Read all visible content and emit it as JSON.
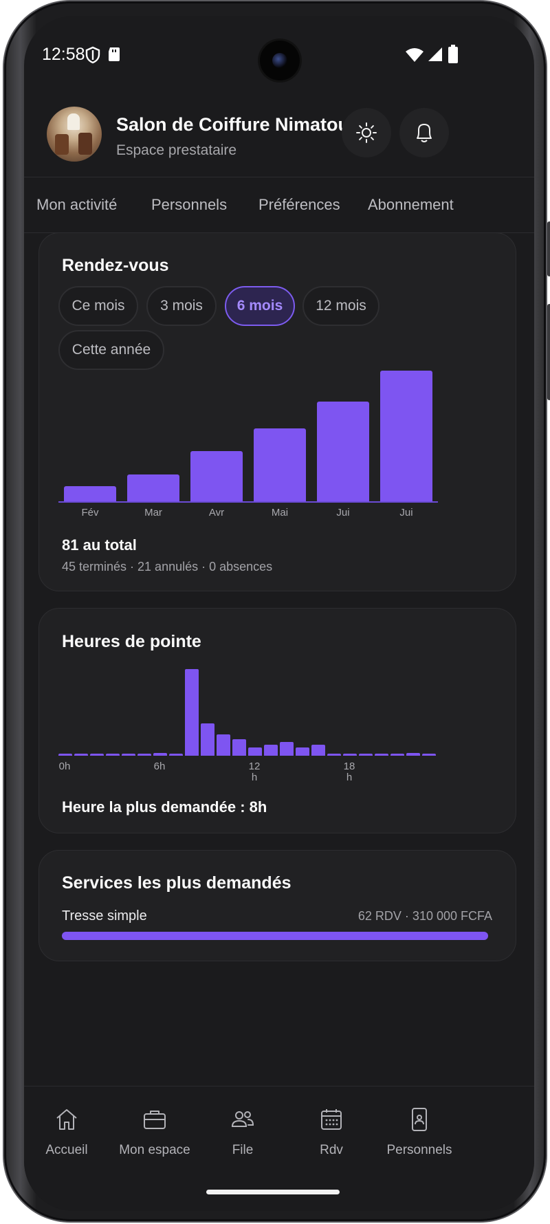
{
  "status_bar": {
    "time": "12:58"
  },
  "header": {
    "title": "Salon de Coiffure Nimatou",
    "subtitle": "Espace prestataire",
    "theme_icon": "sun-icon",
    "notif_icon": "bell-icon"
  },
  "tabs": [
    "Mon activité",
    "Personnels",
    "Préférences",
    "Abonnement"
  ],
  "appointments": {
    "title": "Rendez-vous",
    "ranges": [
      "Ce mois",
      "3 mois",
      "6 mois",
      "12 mois",
      "Cette année"
    ],
    "selected_range": "6 mois",
    "total": "81 au total",
    "detail": "45 terminés · 21 annulés · 0 absences"
  },
  "peak": {
    "title": "Heures de pointe",
    "tick_0": "0h",
    "tick_6": "6h",
    "tick_12_num": "12",
    "tick_12_unit": "h",
    "tick_18_num": "18",
    "tick_18_unit": "h",
    "summary": "Heure la plus demandée : 8h"
  },
  "services": {
    "title": "Services les plus demandés",
    "items": [
      {
        "name": "Tresse simple",
        "stats": "62 RDV · 310 000 FCFA",
        "share": 1.0
      }
    ]
  },
  "bottom_nav": [
    {
      "label": "Accueil",
      "icon": "home-icon"
    },
    {
      "label": "Mon espace",
      "icon": "briefcase-icon"
    },
    {
      "label": "File",
      "icon": "users-icon"
    },
    {
      "label": "Rdv",
      "icon": "calendar-icon"
    },
    {
      "label": "Personnels",
      "icon": "phone-badge-icon"
    }
  ],
  "colors": {
    "accent": "#7e55f1",
    "background": "#1b1b1d",
    "card": "#212123"
  },
  "chart_data": [
    {
      "type": "bar",
      "title": "Rendez-vous",
      "categories": [
        "Fév",
        "Mar",
        "Avr",
        "Mai",
        "Jui",
        "Jui"
      ],
      "values": [
        4,
        7,
        13,
        19,
        26,
        34
      ],
      "ylim": [
        0,
        34
      ]
    },
    {
      "type": "bar",
      "title": "Heures de pointe",
      "x": [
        0,
        1,
        2,
        3,
        4,
        5,
        6,
        7,
        8,
        9,
        10,
        11,
        12,
        13,
        14,
        15,
        16,
        17,
        18,
        19,
        20,
        21,
        22,
        23
      ],
      "values": [
        0.3,
        0.3,
        0.3,
        0.3,
        0.3,
        0.3,
        0.5,
        0.4,
        16,
        6,
        4,
        3,
        1.5,
        2,
        2.5,
        1.5,
        2,
        0.4,
        0.3,
        0.3,
        0.3,
        0.3,
        0.5,
        0.3
      ],
      "x_ticks": [
        "0h",
        "6h",
        "12 h",
        "18 h"
      ]
    }
  ]
}
